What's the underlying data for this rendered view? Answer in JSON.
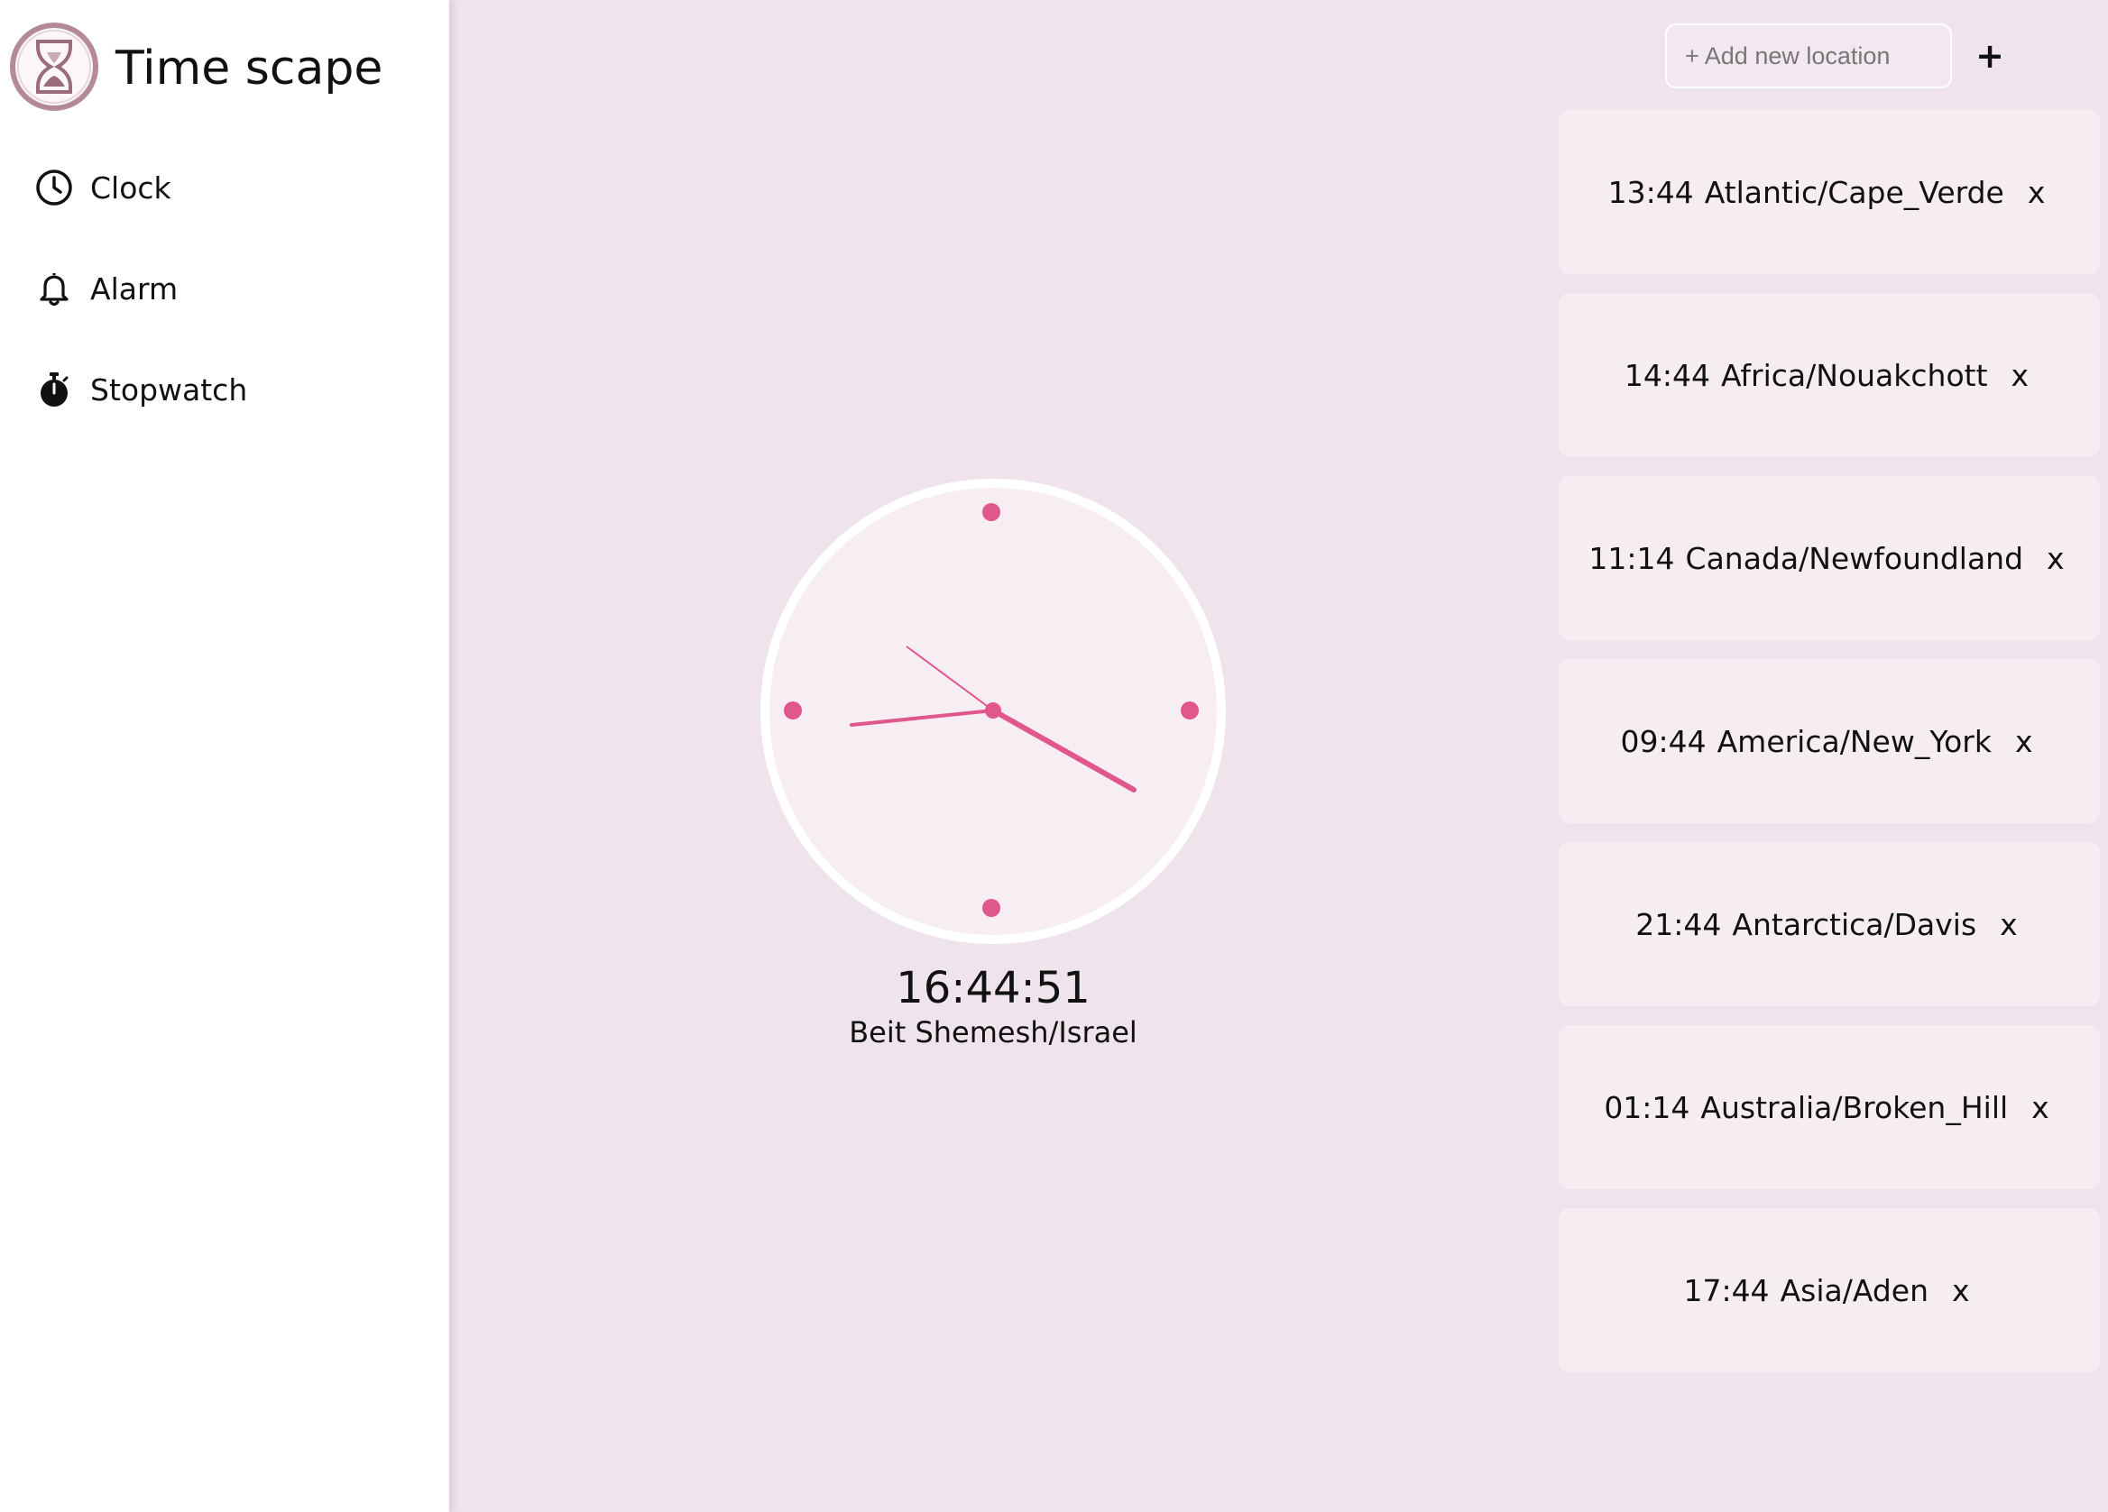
{
  "app": {
    "title": "Time scape"
  },
  "sidebar": {
    "items": [
      {
        "label": "Clock",
        "icon": "clock-icon"
      },
      {
        "label": "Alarm",
        "icon": "bell-icon"
      },
      {
        "label": "Stopwatch",
        "icon": "stopwatch-icon"
      }
    ]
  },
  "clock": {
    "time": "16:44:51",
    "location": "Beit Shemesh/Israel",
    "accent_color": "#e0578a"
  },
  "add_location": {
    "placeholder": "+ Add new location",
    "button_label": "+"
  },
  "locations": [
    {
      "time": "13:44",
      "zone": "Atlantic/Cape_Verde",
      "close": "x"
    },
    {
      "time": "14:44",
      "zone": "Africa/Nouakchott",
      "close": "x"
    },
    {
      "time": "11:14",
      "zone": "Canada/Newfoundland",
      "close": "x"
    },
    {
      "time": "09:44",
      "zone": "America/New_York",
      "close": "x"
    },
    {
      "time": "21:44",
      "zone": "Antarctica/Davis",
      "close": "x"
    },
    {
      "time": "01:14",
      "zone": "Australia/Broken_Hill",
      "close": "x"
    },
    {
      "time": "17:44",
      "zone": "Asia/Aden",
      "close": "x"
    }
  ],
  "colors": {
    "background": "#f0e4ec",
    "card": "#f5edf2",
    "clock_face": "#f6eef3",
    "accent": "#e0578a"
  }
}
